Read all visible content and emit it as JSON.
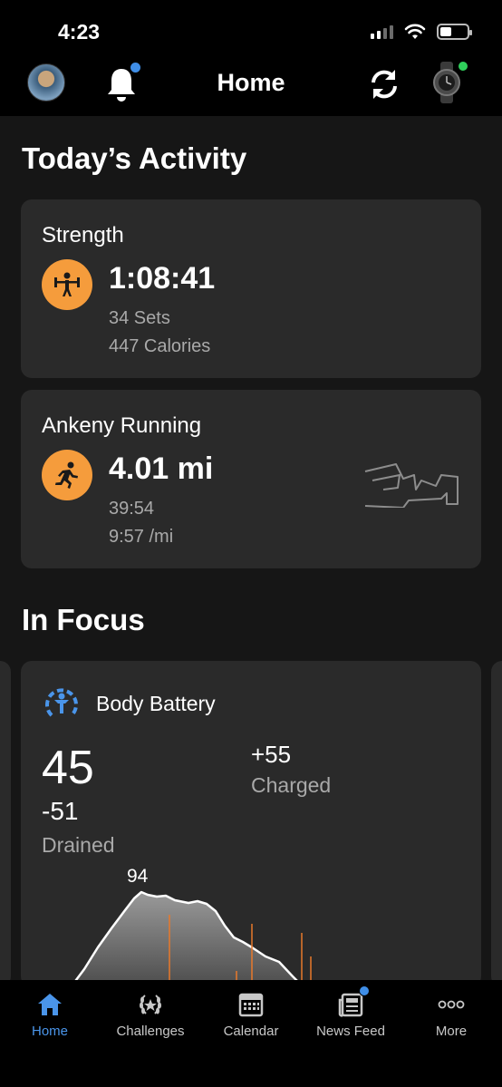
{
  "status": {
    "time": "4:23"
  },
  "header": {
    "title": "Home"
  },
  "activity": {
    "title": "Today’s Activity",
    "items": [
      {
        "name": "Strength",
        "metric": "1:08:41",
        "line1": "34 Sets",
        "line2": "447 Calories",
        "icon": "weightlifting-icon"
      },
      {
        "name": "Ankeny Running",
        "metric": "4.01 mi",
        "line1": "39:54",
        "line2": "9:57 /mi",
        "icon": "running-icon"
      }
    ]
  },
  "focus": {
    "title": "In Focus",
    "body_battery": {
      "title": "Body Battery",
      "current": "45",
      "drained": "-51",
      "drained_label": "Drained",
      "charged": "+55",
      "charged_label": "Charged",
      "peak": "94"
    }
  },
  "tabs": [
    {
      "label": "Home",
      "icon": "home-icon",
      "active": true
    },
    {
      "label": "Challenges",
      "icon": "laurel-icon",
      "active": false
    },
    {
      "label": "Calendar",
      "icon": "calendar-icon",
      "active": false
    },
    {
      "label": "News Feed",
      "icon": "newspaper-icon",
      "active": false,
      "badge": true
    },
    {
      "label": "More",
      "icon": "more-icon",
      "active": false
    }
  ],
  "colors": {
    "accent": "#4a95ea",
    "activity_orange": "#f59c3c",
    "badge_blue": "#3f8ee7",
    "device_green": "#2fcf5b"
  }
}
